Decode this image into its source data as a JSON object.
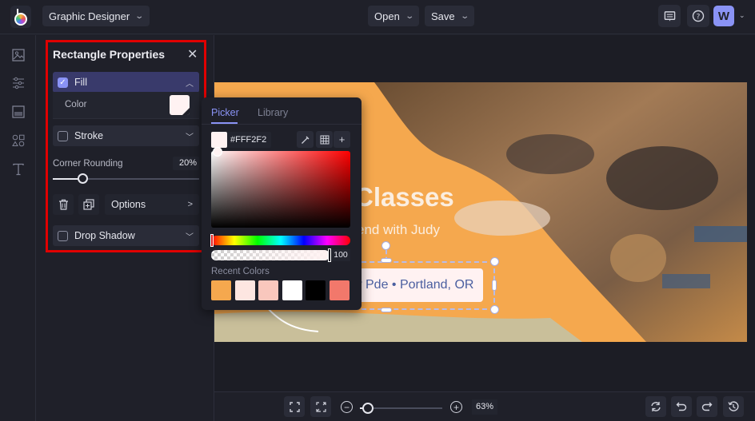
{
  "header": {
    "app_menu_label": "Graphic Designer",
    "open_label": "Open",
    "save_label": "Save",
    "avatar_initial": "W"
  },
  "sidebar_icons": [
    "image-icon",
    "adjustments-icon",
    "layout-icon",
    "shapes-icon",
    "text-icon"
  ],
  "properties_panel": {
    "title": "Rectangle Properties",
    "fill": {
      "label": "Fill",
      "checked": true,
      "expanded": true
    },
    "color_label": "Color",
    "color_value": "#FFF2F2",
    "stroke": {
      "label": "Stroke",
      "checked": false
    },
    "corner_rounding_label": "Corner Rounding",
    "corner_rounding_value": "20%",
    "corner_rounding_fraction": 0.2,
    "options_label": "Options",
    "drop_shadow": {
      "label": "Drop Shadow",
      "checked": false
    }
  },
  "color_picker": {
    "tabs": [
      {
        "label": "Picker",
        "active": true
      },
      {
        "label": "Library",
        "active": false
      }
    ],
    "hex_value": "#FFF2F2",
    "opacity_value": "100",
    "recent_colors_label": "Recent Colors",
    "recent_colors": [
      "#F5A84E",
      "#FDE6E1",
      "#F9C7BD",
      "#FFFFFF",
      "#000000",
      "#F2786B"
    ]
  },
  "canvas": {
    "headline": "Classes",
    "subline": "end with Judy",
    "address": "w Pde • Portland, OR"
  },
  "bottom_bar": {
    "zoom_value": "63%",
    "zoom_fraction": 0.1
  }
}
